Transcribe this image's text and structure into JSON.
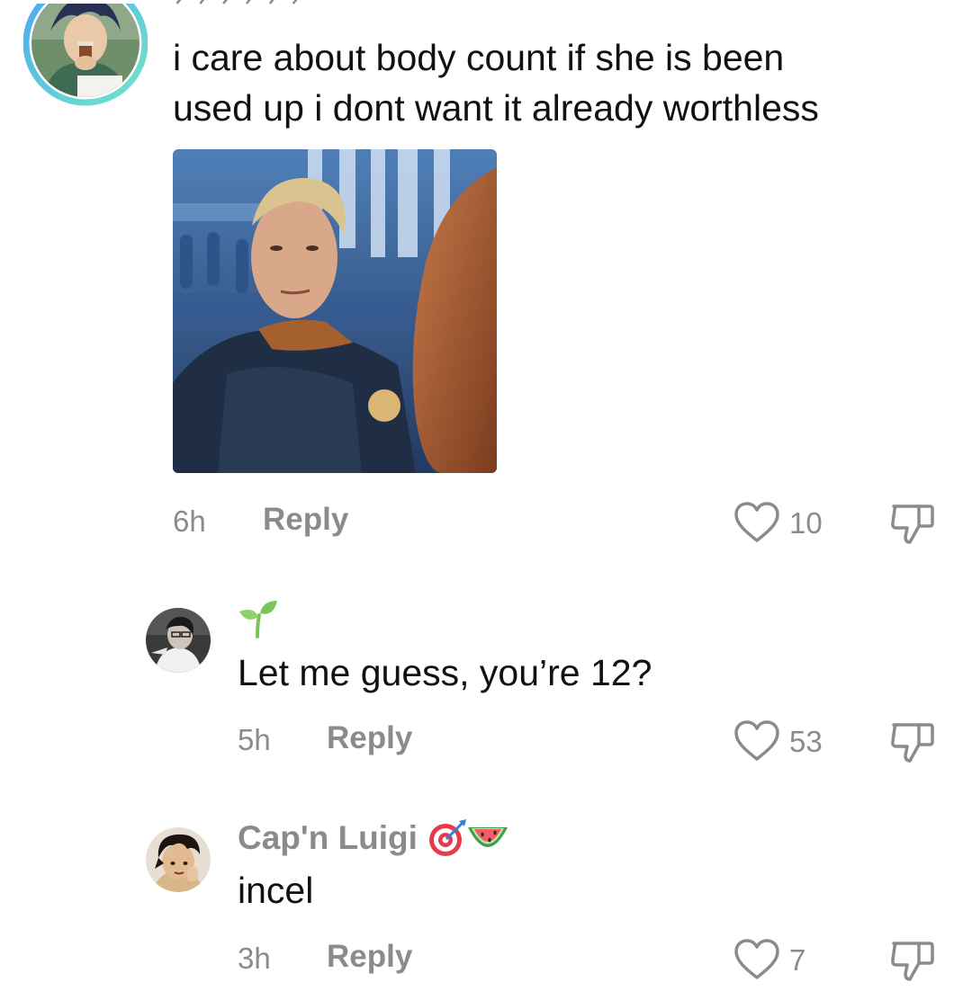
{
  "comments": [
    {
      "username_cutoff": "ᐟ ᐟ ᐟ   ᐟ ᐟ ᐟ",
      "text_line1": "i care about body count if she is been",
      "text_line2": "used up i dont want it already worthless",
      "has_image": true,
      "time": "6h",
      "reply_label": "Reply",
      "likes": "10"
    },
    {
      "username_emoji": "seedling-emoji",
      "text": "Let me guess, you’re 12?",
      "time": "5h",
      "reply_label": "Reply",
      "likes": "53"
    },
    {
      "username": "Cap'n Luigi",
      "username_emojis": [
        "target-emoji",
        "watermelon-emoji"
      ],
      "text": "incel",
      "time": "3h",
      "reply_label": "Reply",
      "likes": "7"
    }
  ],
  "colors": {
    "meta_gray": "#8b8b8b",
    "ring_blue": "#5ab6f0",
    "ring_teal": "#6fe0cc"
  }
}
